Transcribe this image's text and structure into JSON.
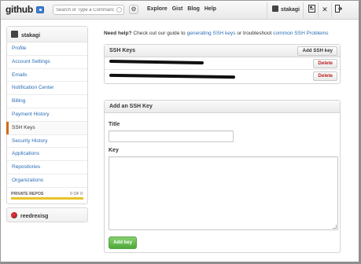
{
  "header": {
    "logo": "github",
    "search_placeholder": "Search or Type a Command",
    "nav": [
      "Explore",
      "Gist",
      "Blog",
      "Help"
    ],
    "username": "stakagi"
  },
  "sidebar": {
    "username": "stakagi",
    "items": [
      {
        "label": "Profile",
        "active": false
      },
      {
        "label": "Account Settings",
        "active": false
      },
      {
        "label": "Emails",
        "active": false
      },
      {
        "label": "Notification Center",
        "active": false
      },
      {
        "label": "Billing",
        "active": false
      },
      {
        "label": "Payment History",
        "active": false
      },
      {
        "label": "SSH Keys",
        "active": true
      },
      {
        "label": "Security History",
        "active": false
      },
      {
        "label": "Applications",
        "active": false
      },
      {
        "label": "Repositories",
        "active": false
      },
      {
        "label": "Organizations",
        "active": false
      }
    ],
    "private_repos_label": "PRIVATE REPOS",
    "private_repos_count": "0 OF 0",
    "private_repos_fill": 1.0,
    "org_name": "reedrexisg"
  },
  "main": {
    "help_prefix": "Need help?",
    "help_text": " Check out our guide to ",
    "help_link1": "generating SSH keys",
    "help_middle": " or troubleshoot ",
    "help_link2": "common SSH Problems",
    "ssh_panel_title": "SSH Keys",
    "add_ssh_key_button": "Add SSH key",
    "delete_label": "Delete",
    "add_panel_title": "Add an SSH Key",
    "title_label": "Title",
    "title_value": "",
    "key_label": "Key",
    "key_value": "",
    "submit_label": "Add key"
  },
  "colors": {
    "link": "#2a6db5",
    "active_marker": "#d26911",
    "delete": "#b52222",
    "submit": "#4fa83a",
    "progress": "#e8c32a"
  }
}
